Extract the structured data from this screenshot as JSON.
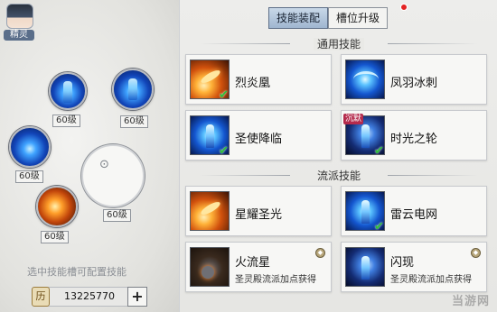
{
  "spirit": {
    "label": "精灵"
  },
  "slots": [
    {
      "level": "60级"
    },
    {
      "level": "60级"
    },
    {
      "level": "60级"
    },
    {
      "level": "60级"
    },
    {
      "level": "60级"
    }
  ],
  "hint": "选中技能槽可配置技能",
  "currency": {
    "value": "13225770",
    "icon": "历",
    "plus": "+"
  },
  "tabs": {
    "skill_equip": "技能装配",
    "slot_upgrade": "槽位升级"
  },
  "sections": {
    "common": "通用技能",
    "school": "流派技能"
  },
  "skills": {
    "common": [
      {
        "name": "烈炎凰",
        "icon": "fire-phoenix-icon",
        "equipped": true
      },
      {
        "name": "凤羽冰刺",
        "icon": "ice-phoenix-icon",
        "equipped": false
      },
      {
        "name": "圣使降临",
        "icon": "holy-descent-icon",
        "equipped": true
      },
      {
        "name": "时光之轮",
        "icon": "time-wheel-icon",
        "equipped": true,
        "tag": "沉默"
      }
    ],
    "school": [
      {
        "name": "星耀圣光",
        "icon": "star-light-icon",
        "equipped": false
      },
      {
        "name": "雷云电网",
        "icon": "thunder-net-icon",
        "equipped": true
      },
      {
        "name": "火流星",
        "icon": "meteor-icon",
        "equipped": false,
        "note": "圣灵殿流派加点获得"
      },
      {
        "name": "闪现",
        "icon": "blink-icon",
        "equipped": false,
        "note": "圣灵殿流派加点获得"
      }
    ]
  },
  "watermark": "当游网"
}
